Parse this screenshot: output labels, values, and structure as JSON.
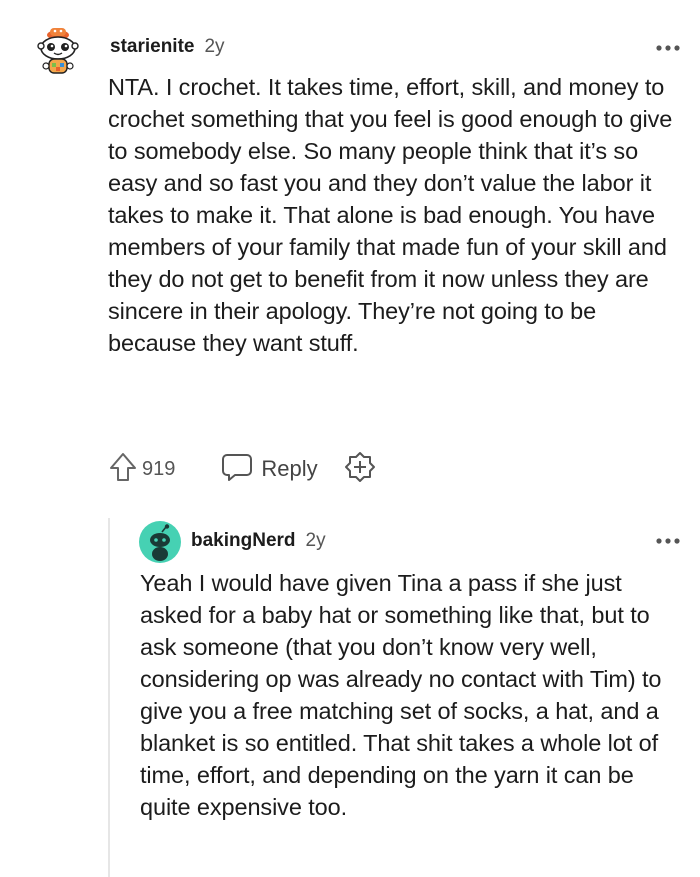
{
  "comments": [
    {
      "username": "starienite",
      "age": "2y",
      "body": "NTA. I crochet. It takes time, effort, skill, and money to crochet something that you feel is good enough to give to somebody else. So many people think that it’s so easy and so fast you and they don’t value the labor it takes to make it. That alone is bad enough. You have members of your family that made fun of your skill and they do not get to benefit from it now unless they are sincere in their apology. They’re not going to be because they want stuff.",
      "votes": "919",
      "reply_label": "Reply",
      "avatar_icon": "snoo-avatar-icon"
    },
    {
      "username": "bakingNerd",
      "age": "2y",
      "body": "Yeah I would have given Tina a pass if she just asked for a baby hat or something like that, but to ask someone (that you don’t know very well, considering op was already no contact with Tim) to give you a free matching set of socks, a hat, and a blanket is so entitled. That shit takes a whole lot of time, effort, and depending on the yarn it can be quite expensive too.",
      "avatar_icon": "default-snoo-icon",
      "avatar_color": "#46d1b3"
    }
  ],
  "colors": {
    "text": "#1c1c1c",
    "muted": "#555555",
    "thread_line": "#e6e6e6"
  }
}
